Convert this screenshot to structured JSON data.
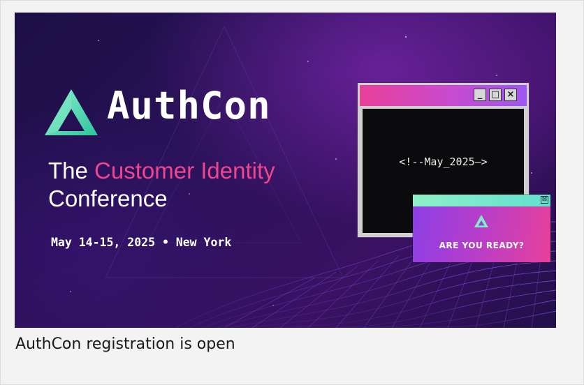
{
  "banner": {
    "brand": "AuthCon",
    "tagline_line1_plain": "The",
    "tagline_line1_highlight": "Customer Identity",
    "tagline_line2": "Conference",
    "event_date": "May 14-15, 2025 • New York",
    "code_window": {
      "controls": [
        "_",
        "□",
        "×"
      ],
      "code_text": "<!--May_2025—>"
    },
    "popup": {
      "close_symbol": "⊠",
      "cta": "ARE YOU READY?"
    }
  },
  "caption": "AuthCon registration is open",
  "colors": {
    "accent_pink": "#f0468e",
    "logo_green": "#4fe3a8",
    "popup_bar": "#8ef0c8"
  },
  "icons": [
    "authcon-logo-icon",
    "minimize-icon",
    "maximize-icon",
    "close-icon",
    "popup-close-icon",
    "triangle-logo-icon"
  ]
}
